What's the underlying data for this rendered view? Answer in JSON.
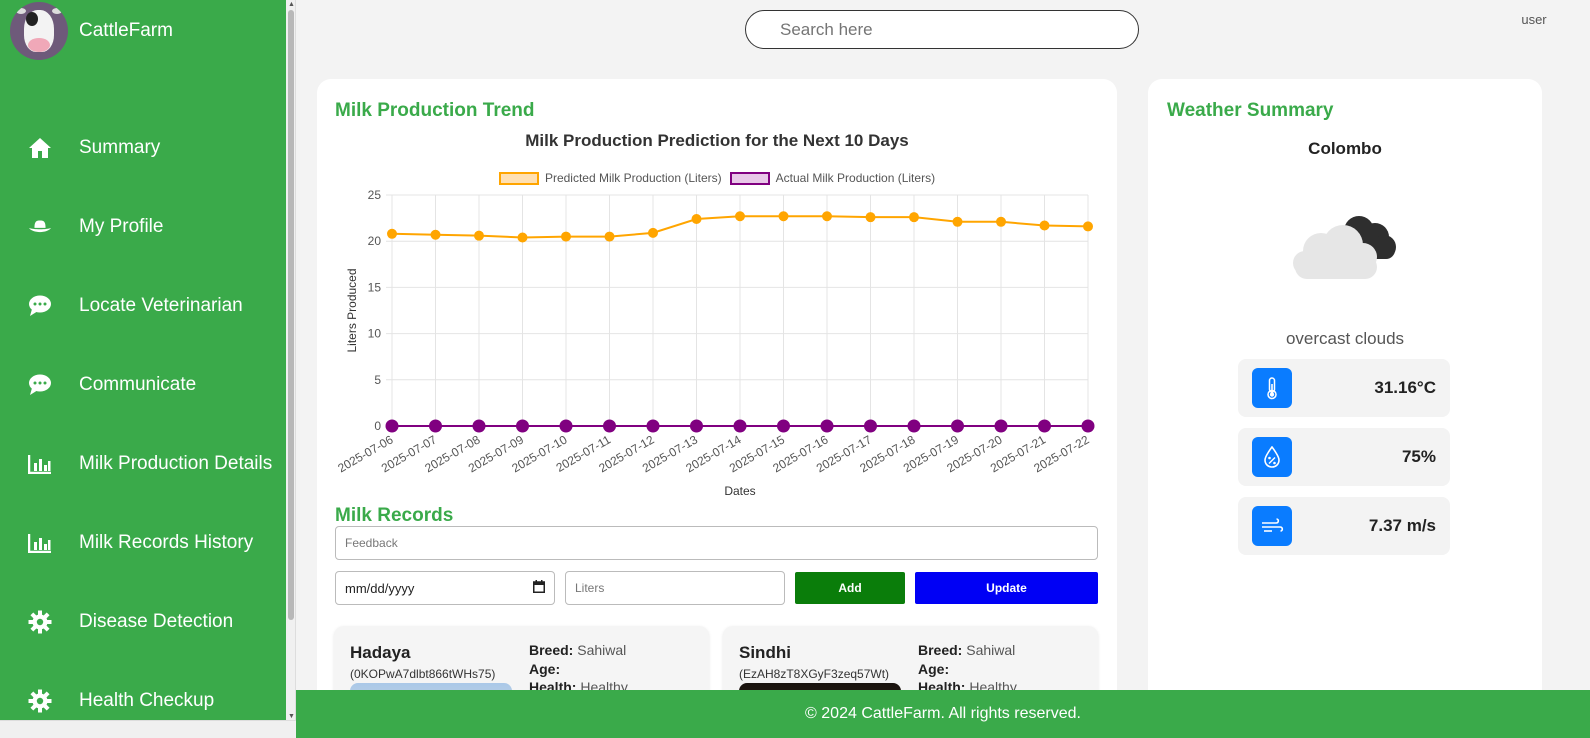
{
  "app": {
    "name": "CattleFarm"
  },
  "sidebar": {
    "items": [
      {
        "label": "Summary",
        "icon": "home-icon"
      },
      {
        "label": "My Profile",
        "icon": "cowboy-hat-icon"
      },
      {
        "label": "Locate Veterinarian",
        "icon": "chat-bubble-icon"
      },
      {
        "label": "Communicate",
        "icon": "chat-bubble-icon"
      },
      {
        "label": "Milk Production Details",
        "icon": "bar-chart-icon"
      },
      {
        "label": "Milk Records History",
        "icon": "bar-chart-icon"
      },
      {
        "label": "Disease Detection",
        "icon": "gear-icon"
      },
      {
        "label": "Health Checkup",
        "icon": "gear-icon"
      }
    ]
  },
  "header": {
    "search_placeholder": "Search here",
    "user_alt": "user"
  },
  "trend": {
    "section_title": "Milk Production Trend"
  },
  "chart_data": {
    "type": "line",
    "title": "Milk Production Prediction for the Next 10 Days",
    "xlabel": "Dates",
    "ylabel": "Liters Produced",
    "ylim": [
      0,
      25
    ],
    "yticks": [
      0,
      5,
      10,
      15,
      20,
      25
    ],
    "grid": true,
    "legend_position": "top",
    "x": [
      "2025-07-06",
      "2025-07-07",
      "2025-07-08",
      "2025-07-09",
      "2025-07-10",
      "2025-07-11",
      "2025-07-12",
      "2025-07-13",
      "2025-07-14",
      "2025-07-15",
      "2025-07-16",
      "2025-07-17",
      "2025-07-18",
      "2025-07-19",
      "2025-07-20",
      "2025-07-21",
      "2025-07-22"
    ],
    "series": [
      {
        "name": "Predicted Milk Production (Liters)",
        "color": "#ffa500",
        "fill": "#ffe0b2",
        "values": [
          20.8,
          20.7,
          20.6,
          20.4,
          20.5,
          20.5,
          20.9,
          22.4,
          22.7,
          22.7,
          22.7,
          22.6,
          22.6,
          22.1,
          22.1,
          21.7,
          21.6
        ]
      },
      {
        "name": "Actual Milk Production (Liters)",
        "color": "#800080",
        "fill": "#e8c8e8",
        "values": [
          0,
          0,
          0,
          0,
          0,
          0,
          0,
          0,
          0,
          0,
          0,
          0,
          0,
          0,
          0,
          0,
          0
        ]
      }
    ]
  },
  "records": {
    "section_title": "Milk Records",
    "feedback_placeholder": "Feedback",
    "date_placeholder": "mm/dd/yyyy",
    "liters_placeholder": "Liters",
    "add_label": "Add",
    "update_label": "Update"
  },
  "cows": [
    {
      "name": "Hadaya",
      "id": "(0KOPwA7dlbt866tWHs75)",
      "breed_label": "Breed:",
      "breed": "Sahiwal",
      "age_label": "Age:",
      "age": "",
      "health_label": "Health:",
      "health": "Healthy"
    },
    {
      "name": "Sindhi",
      "id": "(EzAH8zT8XGyF3zeq57Wt)",
      "breed_label": "Breed:",
      "breed": "Sahiwal",
      "age_label": "Age:",
      "age": "",
      "health_label": "Health:",
      "health": "Healthy"
    }
  ],
  "weather": {
    "section_title": "Weather Summary",
    "city": "Colombo",
    "description": "overcast clouds",
    "icon": "overcast-clouds-icon",
    "temperature": "31.16°C",
    "humidity": "75%",
    "wind": "7.37 m/s"
  },
  "footer": {
    "text": "© 2024 CattleFarm. All rights reserved."
  },
  "colors": {
    "primary_green": "#3aaa4a",
    "add_button": "#0a7d0a",
    "update_button": "#0000f5",
    "weather_icon_bg": "#0a7cff"
  }
}
